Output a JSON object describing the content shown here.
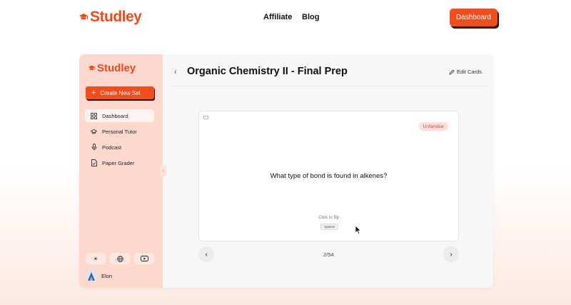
{
  "topnav": {
    "brand": "Studley",
    "links": [
      "Affiliate",
      "Blog"
    ],
    "dashboard_label": "Dashboard"
  },
  "sidebar": {
    "brand": "Studley",
    "create_label": "Create New Set",
    "items": [
      {
        "label": "Dashboard",
        "icon": "grid-icon",
        "active": true
      },
      {
        "label": "Personal Tutor",
        "icon": "graduation-cap-icon",
        "active": false
      },
      {
        "label": "Podcast",
        "icon": "microphone-icon",
        "active": false
      },
      {
        "label": "Paper Grader",
        "icon": "document-check-icon",
        "active": false
      }
    ],
    "bottom_icons": [
      "sun-icon",
      "globe-icon",
      "youtube-icon"
    ],
    "user": {
      "name": "Elon"
    }
  },
  "main": {
    "title": "Organic Chemistry II - Final Prep",
    "edit_label": "Edit Cards",
    "card": {
      "badge": "Unfamiliar",
      "question": "What type of bond is found in alkenes?",
      "flip_hint": "Click to flip",
      "key": "space"
    },
    "pagination": "2/54"
  },
  "colors": {
    "accent": "#f24d1d",
    "sidebar_bg": "#fdd9cd",
    "badge_bg": "#fde0dc",
    "badge_text": "#d84a3a"
  }
}
